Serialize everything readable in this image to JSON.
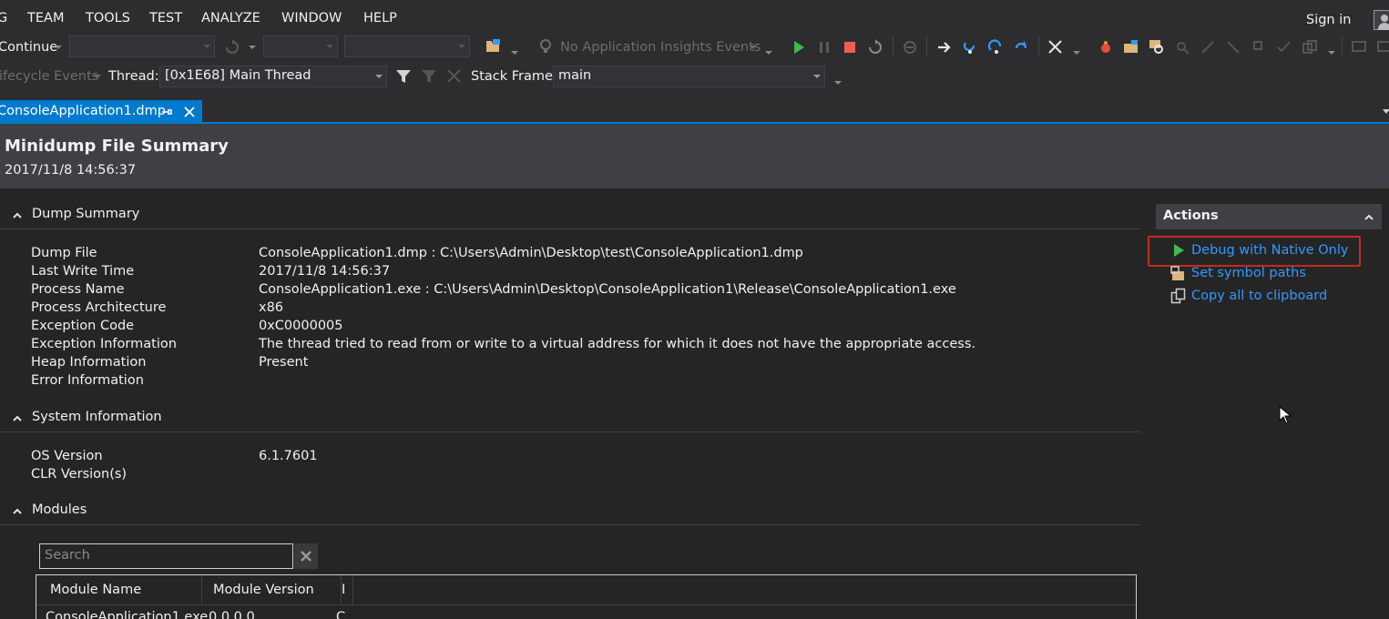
{
  "menu": {
    "items": [
      "G",
      "TEAM",
      "TOOLS",
      "TEST",
      "ANALYZE",
      "WINDOW",
      "HELP"
    ],
    "sign_in": "Sign in"
  },
  "toolbar1": {
    "continue_label": "Continue",
    "app_insights": "No Application Insights Events"
  },
  "toolbar2": {
    "lifecycle_label": "ifecycle Events",
    "thread_label": "Thread:",
    "thread_value": "[0x1E68] Main Thread",
    "stack_label": "Stack Frame:",
    "stack_value": "main"
  },
  "tab": {
    "label": "ConsoleApplication1.dmp"
  },
  "header": {
    "title": "Minidump File Summary",
    "date": "2017/11/8 14:56:37"
  },
  "dump_summary": {
    "heading": "Dump Summary",
    "rows": [
      {
        "label": "Dump File",
        "value": "ConsoleApplication1.dmp : C:\\Users\\Admin\\Desktop\\test\\ConsoleApplication1.dmp"
      },
      {
        "label": "Last Write Time",
        "value": "2017/11/8 14:56:37"
      },
      {
        "label": "Process Name",
        "value": "ConsoleApplication1.exe : C:\\Users\\Admin\\Desktop\\ConsoleApplication1\\Release\\ConsoleApplication1.exe"
      },
      {
        "label": "Process Architecture",
        "value": "x86"
      },
      {
        "label": "Exception Code",
        "value": "0xC0000005"
      },
      {
        "label": "Exception Information",
        "value": "The thread tried to read from or write to a virtual address for which it does not have the appropriate access."
      },
      {
        "label": "Heap Information",
        "value": "Present"
      },
      {
        "label": "Error Information",
        "value": ""
      }
    ]
  },
  "system_info": {
    "heading": "System Information",
    "rows": [
      {
        "label": "OS Version",
        "value": "6.1.7601"
      },
      {
        "label": "CLR Version(s)",
        "value": ""
      }
    ]
  },
  "modules": {
    "heading": "Modules",
    "search_placeholder": "Search",
    "columns": [
      "Module Name",
      "Module Version",
      "I"
    ],
    "rows": [
      {
        "name": "ConsoleApplication1.exe",
        "version": "0.0.0.0",
        "extra": "C"
      }
    ]
  },
  "actions": {
    "heading": "Actions",
    "items": [
      "Debug with Native Only",
      "Set symbol paths",
      "Copy all to clipboard"
    ]
  },
  "colors": {
    "accent": "#007acc",
    "link": "#3399ff",
    "highlight": "#c42b1c",
    "play": "#3fb950",
    "stop": "#f25c54"
  }
}
